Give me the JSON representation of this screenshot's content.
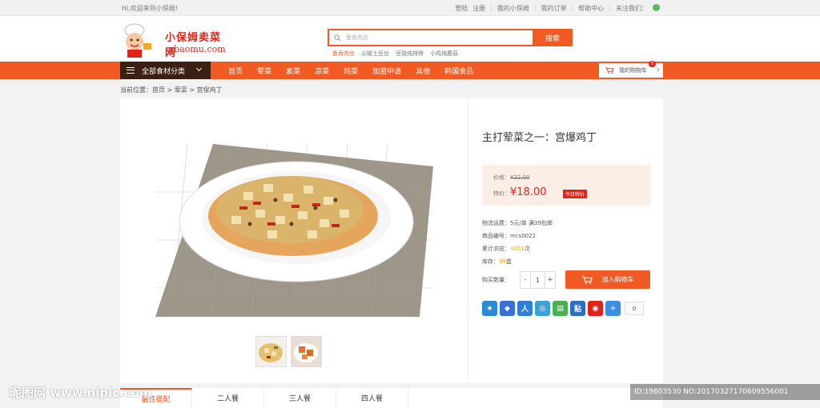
{
  "topbar": {
    "welcome": "Hi,欢迎来到小保姆!",
    "links": [
      "登陆",
      "注册",
      "我的小保姆",
      "我的订单",
      "帮助中心",
      "关注我们："
    ]
  },
  "logo": {
    "cn": "小保姆卖菜网",
    "en": "xbaomu.com"
  },
  "search": {
    "placeholder": "鱼香肉丝",
    "button": "搜索",
    "hot": [
      "鱼香肉丝",
      "尖椒土豆丝",
      "豆豉炖排骨",
      "小鸡炖蘑菇"
    ]
  },
  "nav": {
    "category": "全部食材分类",
    "items": [
      "首页",
      "荤菜",
      "素菜",
      "凉菜",
      "炖菜",
      "加盟申请",
      "其他",
      "韩国食品"
    ],
    "cart_label": "我的购物车",
    "cart_count": "0"
  },
  "breadcrumb": "当前位置：首页 > 荤菜 > 宫保鸡丁",
  "product": {
    "title": "主打荤菜之一：宫爆鸡丁",
    "price_label": "价格：",
    "old_price": "¥22.00",
    "special_label": "特价：",
    "special_price": "¥18.00",
    "today_tag": "今日特价",
    "shipping": "物流运费：5元/单 满39包邮",
    "code": "商品编号：mcs0022",
    "views_prefix": "累计浏览：",
    "views": "4051",
    "views_suffix": "次",
    "stock_prefix": "库存：",
    "stock": "99",
    "stock_suffix": "盒",
    "qty_label": "购买数量：",
    "qty_minus": "-",
    "qty_value": "1",
    "qty_plus": "+",
    "add_cart": "加入购物车",
    "share_count": "0"
  },
  "tabs": [
    "最佳搭配",
    "二人餐",
    "三人餐",
    "四人餐"
  ],
  "watermark": {
    "left": "昵图网 www.nipic.com",
    "right": "ID:19603530 NO:20170327170609556001"
  },
  "colors": {
    "accent": "#f15a22",
    "price": "#e2231a",
    "nav_dark": "#3a1f12"
  }
}
